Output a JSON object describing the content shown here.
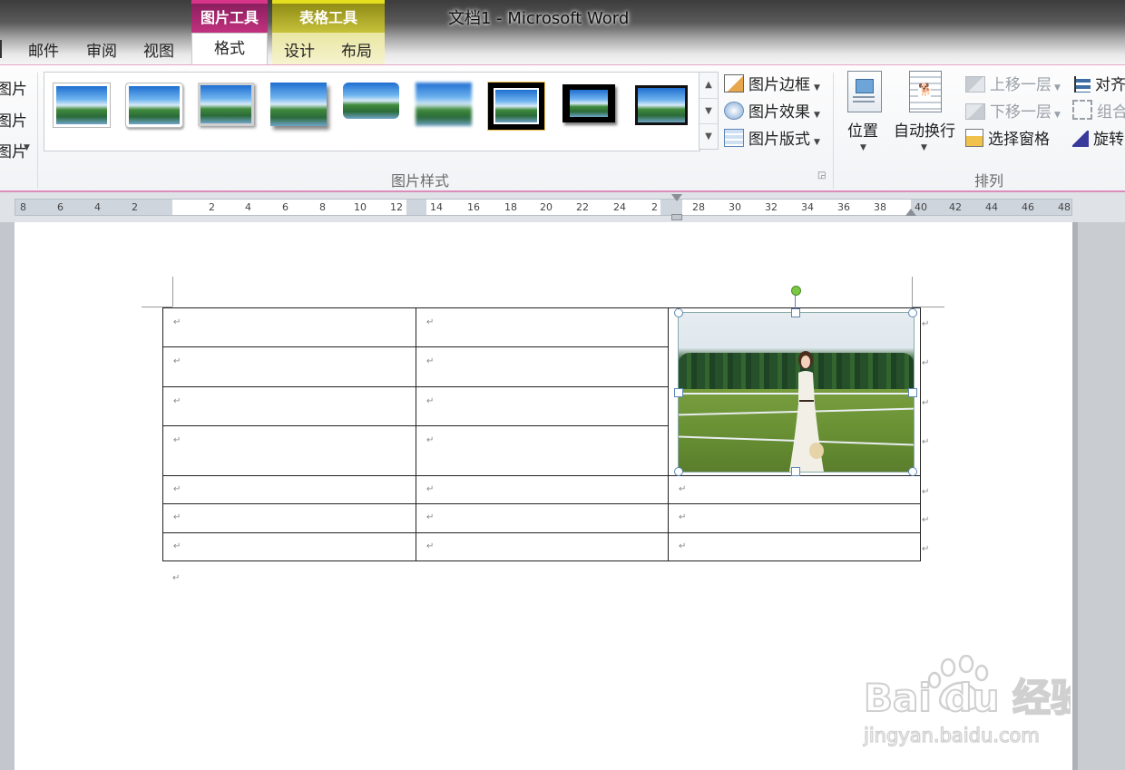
{
  "window": {
    "title": "文档1 - Microsoft Word"
  },
  "context_tabs": {
    "picture_tools": "图片工具",
    "table_tools": "表格工具"
  },
  "tabs": [
    "邮件",
    "审阅",
    "视图",
    "格式",
    "设计",
    "布局"
  ],
  "left_partial": [
    "图片",
    "图片",
    "图片"
  ],
  "picture_styles": {
    "group_label": "图片样式",
    "commands": [
      "图片边框",
      "图片效果",
      "图片版式"
    ]
  },
  "arrange": {
    "group_label": "排列",
    "position": "位置",
    "wrap_text": "自动换行",
    "bring_forward": "上移一层",
    "send_backward": "下移一层",
    "selection_pane": "选择窗格",
    "align": "对齐",
    "group": "组合",
    "rotate": "旋转"
  },
  "ruler": {
    "left_labels": [
      "8",
      "6",
      "4",
      "2"
    ],
    "right_labels": [
      "2",
      "4",
      "6",
      "8",
      "10",
      "12",
      "14",
      "16",
      "18",
      "20",
      "22",
      "24",
      "2",
      "28",
      "30",
      "32",
      "34",
      "36",
      "38",
      "40",
      "42",
      "44",
      "46",
      "48"
    ]
  },
  "document": {
    "paragraph_mark": "↵",
    "table_rows": 7
  },
  "watermark": {
    "brand": "Bai du 经验",
    "url": "jingyan.baidu.com"
  }
}
